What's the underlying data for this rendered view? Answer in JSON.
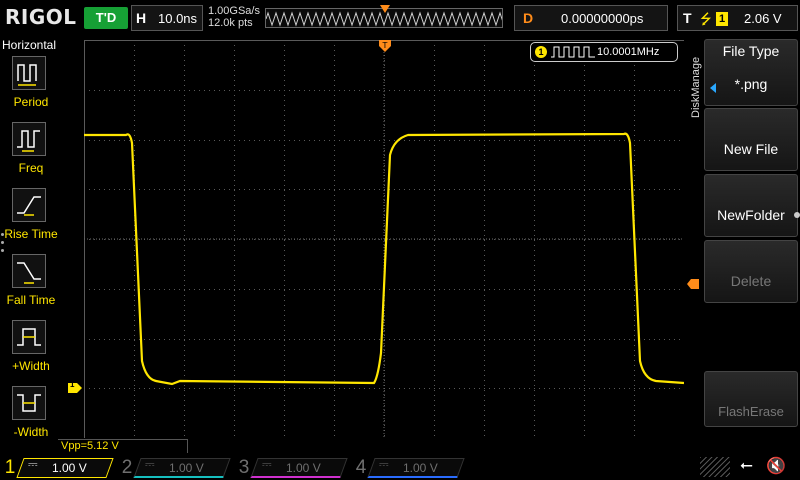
{
  "brand": "RIGOL",
  "status": "T'D",
  "horizontal": {
    "label": "H",
    "timebase": "10.0ns",
    "sample_rate": "1.00GSa/s",
    "points": "12.0k pts"
  },
  "delay": {
    "label": "D",
    "value": "0.00000000ps"
  },
  "trigger": {
    "label": "T",
    "edge_symbol": "⭍",
    "source": "1",
    "level": "2.06 V"
  },
  "left_menu": {
    "title": "Horizontal",
    "items": [
      {
        "label": "Period",
        "icon": "period-icon"
      },
      {
        "label": "Freq",
        "icon": "freq-icon"
      },
      {
        "label": "Rise Time",
        "icon": "rise-time-icon"
      },
      {
        "label": "Fall Time",
        "icon": "fall-time-icon"
      },
      {
        "label": "+Width",
        "icon": "positive-width-icon"
      },
      {
        "label": "-Width",
        "icon": "negative-width-icon"
      }
    ]
  },
  "measurement": {
    "channel": "1",
    "frequency": "10.0001MHz",
    "vpp": "Vpp=5.12 V"
  },
  "channel_marker": "1",
  "right_menu": {
    "section": "DiskManage",
    "items": [
      {
        "title": "File Type",
        "value": "*.png",
        "enabled": true
      },
      {
        "title": "New File",
        "enabled": true
      },
      {
        "title": "NewFolder",
        "enabled": true
      },
      {
        "title": "Delete",
        "enabled": false
      },
      {
        "title": "FlashErase",
        "enabled": false
      }
    ]
  },
  "channels": [
    {
      "num": "1",
      "scale": "1.00 V",
      "active": true
    },
    {
      "num": "2",
      "scale": "1.00 V",
      "active": false
    },
    {
      "num": "3",
      "scale": "1.00 V",
      "active": false
    },
    {
      "num": "4",
      "scale": "1.00 V",
      "active": false
    }
  ],
  "colors": {
    "ch1": "#ffe600",
    "ch2": "#16c0c0",
    "ch3": "#d030d0",
    "ch4": "#2a6cff",
    "trigger": "#ff8c1a",
    "status_running": "#16a035"
  }
}
